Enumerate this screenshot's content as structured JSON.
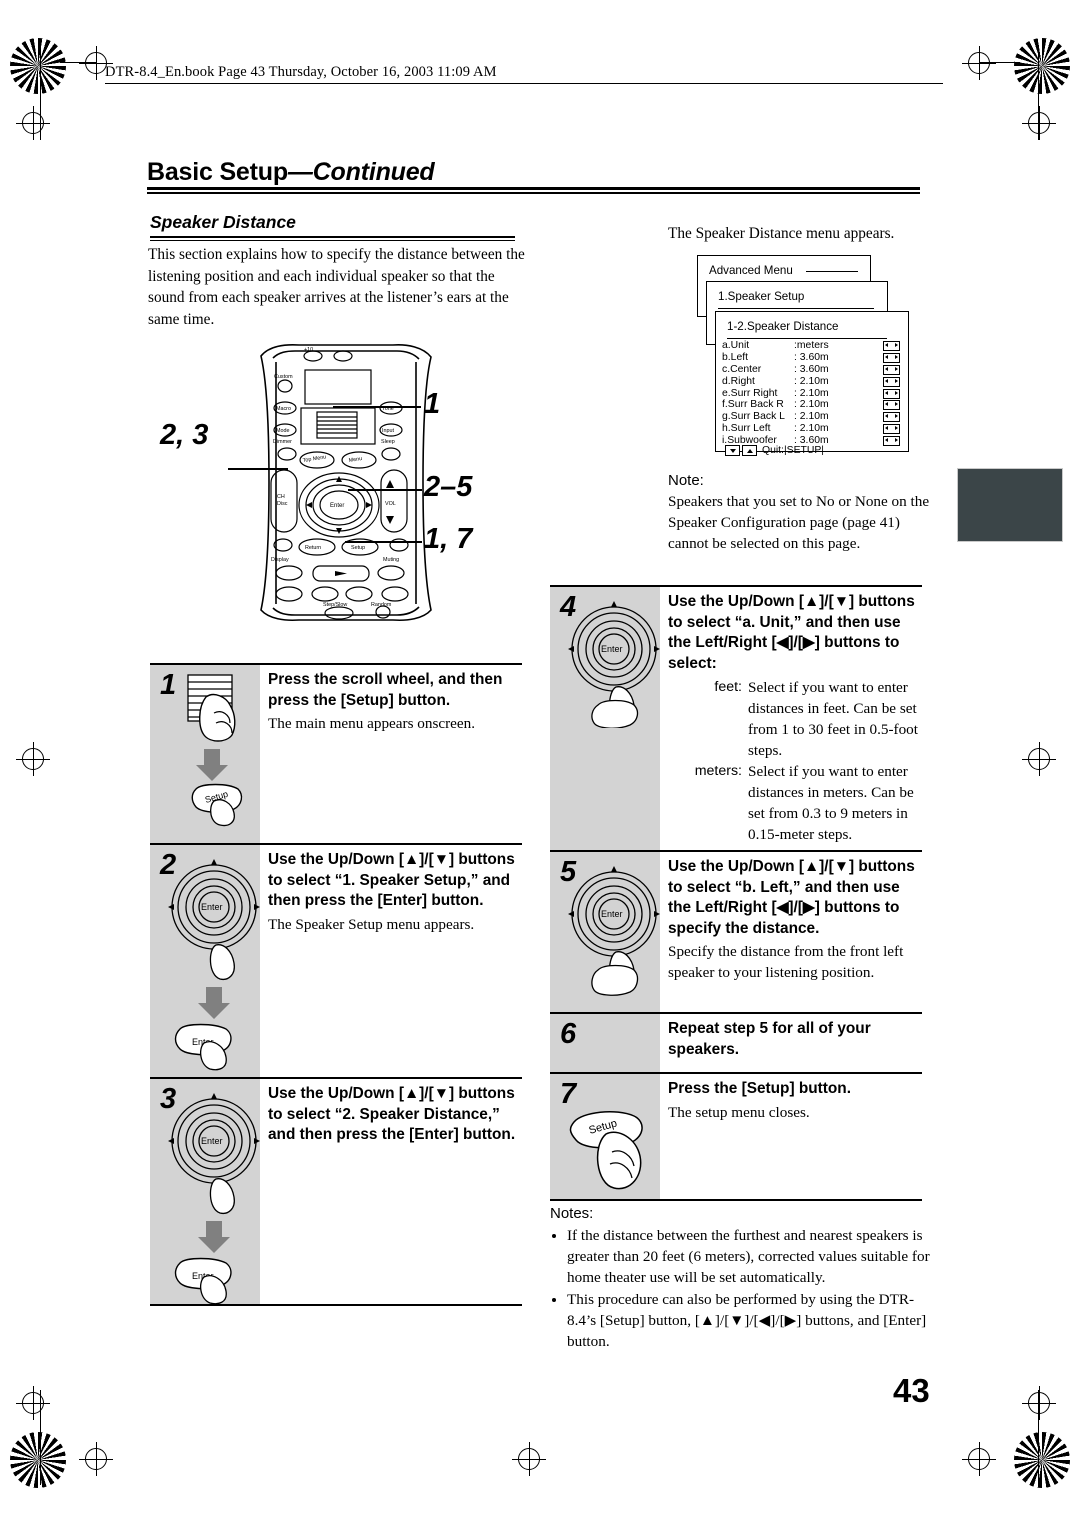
{
  "book_header": "DTR-8.4_En.book  Page 43  Thursday, October 16, 2003  11:09 AM",
  "chapter_title_bold": "Basic Setup",
  "chapter_title_italic": "—Continued",
  "section_title": "Speaker Distance",
  "intro": "This section explains how to specify the distance between the listening position and each individual speaker so that the sound from each speaker arrives at the listener’s ears at the same time.",
  "page_number": "43",
  "remote_callouts": [
    {
      "label": "1"
    },
    {
      "label": "2, 3"
    },
    {
      "label": "2–5"
    },
    {
      "label": "1, 7"
    }
  ],
  "osd": {
    "intro": "The Speaker Distance menu appears.",
    "layer1_title": "Advanced Menu",
    "layer2_title": "1.Speaker Setup",
    "layer3_title": "1-2.Speaker Distance",
    "rows": [
      {
        "label": "a.Unit",
        "value": ":meters"
      },
      {
        "label": "b.Left",
        "value": ": 3.60m"
      },
      {
        "label": "c.Center",
        "value": ": 3.60m"
      },
      {
        "label": "d.Right",
        "value": ": 2.10m"
      },
      {
        "label": "e.Surr Right",
        "value": ": 2.10m"
      },
      {
        "label": "f.Surr Back R",
        "value": ": 2.10m"
      },
      {
        "label": "g.Surr Back L",
        "value": ": 2.10m"
      },
      {
        "label": "h.Surr Left",
        "value": ": 2.10m"
      },
      {
        "label": "i.Subwoofer",
        "value": ": 3.60m"
      }
    ],
    "quit_text": "Quit:|SETUP|"
  },
  "note": {
    "heading": "Note:",
    "body": "Speakers that you set to No or None on the Speaker Configuration page (page 41) cannot be selected on this page."
  },
  "steps_left": [
    {
      "num": "1",
      "head": "Press the scroll wheel, and then press the [Setup] button.",
      "sub": "The main menu appears onscreen.",
      "icon": "scroll-wheel-and-setup-button"
    },
    {
      "num": "2",
      "head": "Use the Up/Down [▲]/[▼] buttons to select “1. Speaker Setup,” and then press the [Enter] button.",
      "sub": "The Speaker Setup menu appears.",
      "icon": "enter-dial-and-enter-button"
    },
    {
      "num": "3",
      "head": "Use the Up/Down [▲]/[▼] buttons to select “2. Speaker Distance,” and then press the [Enter] button.",
      "sub": "",
      "icon": "enter-dial-and-enter-button"
    }
  ],
  "steps_right": [
    {
      "num": "4",
      "head": "Use the Up/Down [▲]/[▼] buttons to select “a. Unit,” and then use the Left/Right [◀]/[▶] buttons to select:",
      "sub": "",
      "icon": "enter-dial"
    },
    {
      "num": "5",
      "head": "Use the Up/Down [▲]/[▼] buttons to select “b. Left,” and then use the Left/Right [◀]/[▶] buttons to specify the distance.",
      "sub": "Specify the distance from the front left speaker to your listening position.",
      "icon": "enter-dial"
    },
    {
      "num": "6",
      "head": "Repeat step 5 for all of your speakers.",
      "sub": "",
      "icon": "none"
    },
    {
      "num": "7",
      "head": "Press the [Setup] button.",
      "sub": "The setup menu closes.",
      "icon": "setup-button"
    }
  ],
  "unit_definitions": [
    {
      "term": "feet:",
      "desc": "Select if you want to enter distances in feet. Can be set from 1 to 30 feet in 0.5-foot steps."
    },
    {
      "term": "meters:",
      "desc": "Select if you want to enter distances in meters. Can be set from 0.3 to 9 meters in 0.15-meter steps."
    }
  ],
  "notes": {
    "heading": "Notes:",
    "items": [
      "If the distance between the furthest and nearest speakers is greater than 20 feet (6 meters), corrected values suitable for home theater use will be set automatically.",
      "This procedure can also be performed by using the DTR-8.4’s [Setup] button, [▲]/[▼]/[◀]/[▶] buttons, and [Enter] button."
    ]
  },
  "remote": {
    "buttons": [
      "+10",
      "Custom",
      "Macro",
      "Mode",
      "Tone",
      "Input",
      "Dimmer",
      "Top Menu",
      "Menu",
      "Sleep",
      "CH Disc",
      "VOL",
      "Return",
      "Setup",
      "Display",
      "Muting",
      "Step/Slow",
      "Random",
      "Enter"
    ]
  }
}
